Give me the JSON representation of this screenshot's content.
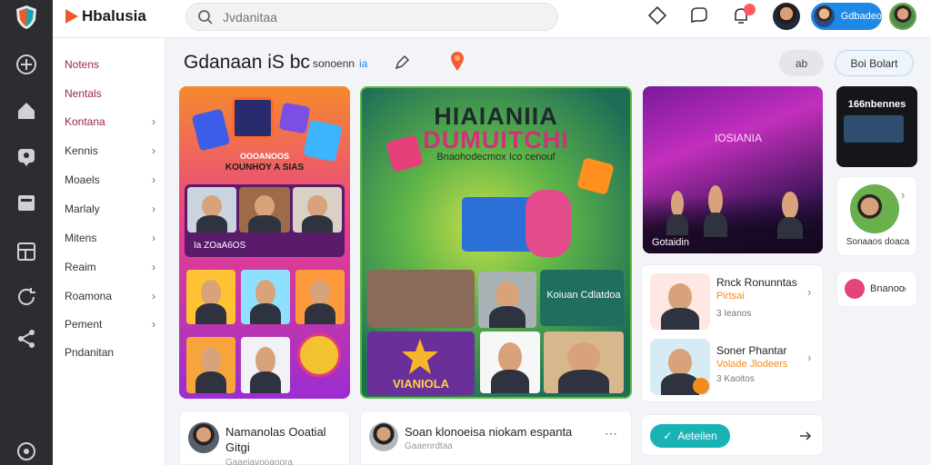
{
  "app": {
    "name": "Hbalusia"
  },
  "search": {
    "placeholder": "Jvdanitaa"
  },
  "user": {
    "pill_label": "Gdbadeo"
  },
  "nav": {
    "items": [
      {
        "label": "Notens",
        "chevron": false,
        "active": true
      },
      {
        "label": "Nentals",
        "chevron": false,
        "active": true
      },
      {
        "label": "Kontana",
        "chevron": true,
        "active": true
      },
      {
        "label": "Kennis",
        "chevron": true,
        "active": false
      },
      {
        "label": "Moaels",
        "chevron": true,
        "active": false
      },
      {
        "label": "Marlaly",
        "chevron": true,
        "active": false
      },
      {
        "label": "Mitens",
        "chevron": true,
        "active": false
      },
      {
        "label": "Reaim",
        "chevron": true,
        "active": false
      },
      {
        "label": "Roamona",
        "chevron": true,
        "active": false
      },
      {
        "label": "Pement",
        "chevron": true,
        "active": false
      },
      {
        "label": "Pndanitan",
        "chevron": false,
        "active": false
      }
    ],
    "chevron_glyph": "›"
  },
  "header": {
    "title": "Gdanaan iS bc",
    "subtitle": "sonoenn",
    "subtitle_link": "ia",
    "btn_gray": "ab",
    "btn_outline": "Boi Bolart"
  },
  "cards": {
    "c1": {
      "banner": "KOUNHOY A SIAS",
      "banner_top": "OOOANOOS",
      "band_label": "Ia ZOaA6OS"
    },
    "c2": {
      "title_line1": "HIAIANIIA",
      "title_line2": "DUMUITCHI",
      "subtitle": "Bnaohodecmox Ico cenouf",
      "panel_text": "Koiuan Cdlatdoa",
      "game_label": "VIANIOLA"
    },
    "c3": {
      "sign": "IOSIANIA",
      "caption": "Gotaidin"
    },
    "c4": {
      "title": "166nbennes"
    },
    "friends": {
      "label": "Sonaaos doaca"
    },
    "mini": {
      "label": "Bnanoo"
    },
    "profiles": [
      {
        "name": "Rnck Ronunntas",
        "role": "Pirtsai",
        "meta": "3 Ieanos"
      },
      {
        "name": "Soner Phantar",
        "role": "Volade Jlodeers",
        "meta": "3 Kaoitos"
      }
    ],
    "action": {
      "label": "Aeteilen"
    },
    "posts": [
      {
        "title": "Namanolas Ooatial",
        "title2": "Gitgi",
        "meta": "Gaaeiavooaoora"
      },
      {
        "title": "Soan klonoeisa niokam espanta",
        "meta": "Gaaenrdtaa"
      }
    ]
  },
  "colors": {
    "accent": "#1e88e5",
    "nav_active": "#9b2255",
    "brand": "#f05a28",
    "teal": "#1ab3b5",
    "orange": "#f28c1c"
  }
}
